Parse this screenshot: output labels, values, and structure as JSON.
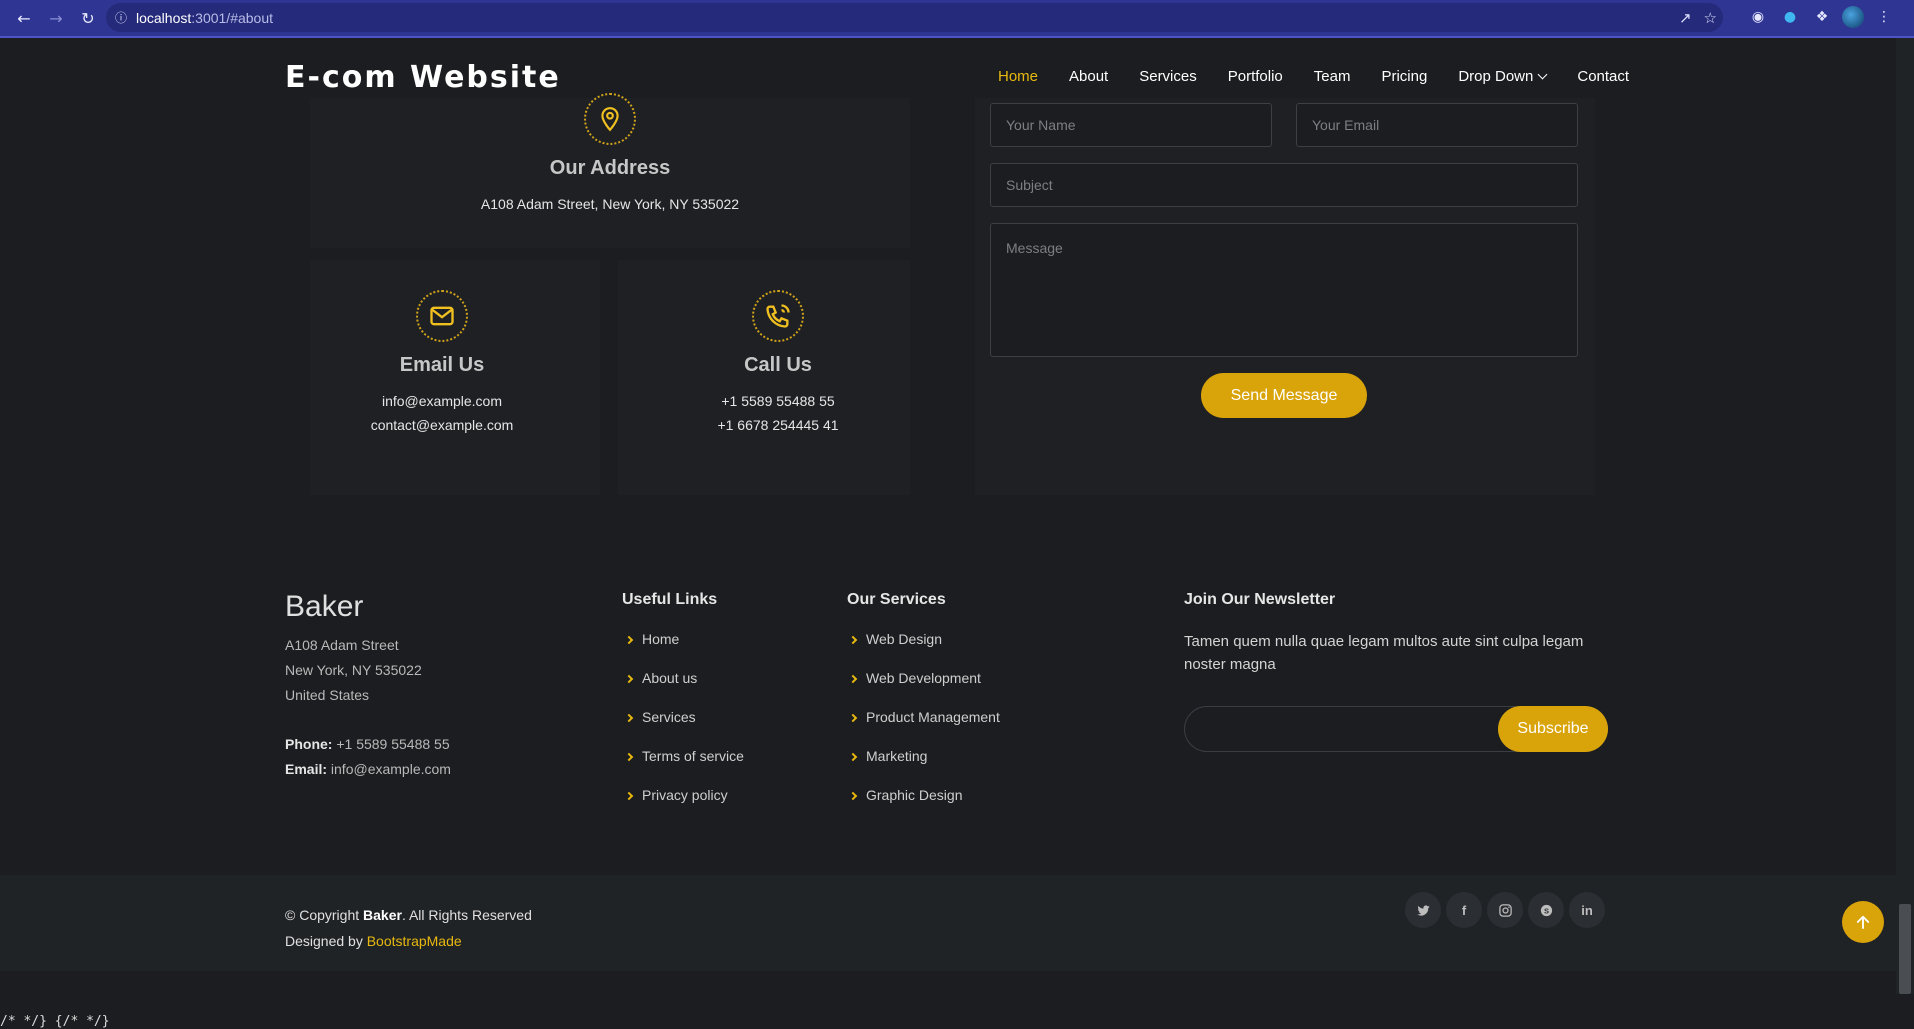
{
  "browser": {
    "url_host": "localhost",
    "url_path": ":3001/#about"
  },
  "header": {
    "brand": "E-com Website",
    "menu": [
      "Home",
      "About",
      "Services",
      "Portfolio",
      "Team",
      "Pricing",
      "Drop Down",
      "Contact"
    ],
    "active": "Home"
  },
  "contact": {
    "address": {
      "title": "Our Address",
      "line": "A108 Adam Street, New York, NY 535022"
    },
    "email": {
      "title": "Email Us",
      "lines": [
        "info@example.com",
        "contact@example.com"
      ]
    },
    "call": {
      "title": "Call Us",
      "lines": [
        "+1 5589 55488 55",
        "+1 6678 254445 41"
      ]
    },
    "form": {
      "name_placeholder": "Your Name",
      "email_placeholder": "Your Email",
      "subject_placeholder": "Subject",
      "message_placeholder": "Message",
      "send_label": "Send Message"
    }
  },
  "footer": {
    "brand": "Baker",
    "address_lines": [
      "A108 Adam Street",
      "New York, NY 535022",
      "United States"
    ],
    "phone_label": "Phone:",
    "phone": "+1 5589 55488 55",
    "email_label": "Email:",
    "email": "info@example.com",
    "useful_links_title": "Useful Links",
    "useful_links": [
      "Home",
      "About us",
      "Services",
      "Terms of service",
      "Privacy policy"
    ],
    "services_title": "Our Services",
    "services": [
      "Web Design",
      "Web Development",
      "Product Management",
      "Marketing",
      "Graphic Design"
    ],
    "newsletter_title": "Join Our Newsletter",
    "newsletter_text": "Tamen quem nulla quae legam multos aute sint culpa legam noster magna",
    "subscribe_label": "Subscribe",
    "copyright_prefix": "© Copyright",
    "copyright_brand": "Baker",
    "copyright_suffix": ". All Rights Reserved",
    "designed_by": "Designed by",
    "designer": "BootstrapMade",
    "social": [
      "twitter-icon",
      "facebook-icon",
      "instagram-icon",
      "skype-icon",
      "linkedin-icon"
    ]
  },
  "stray_text": "/* */} {/* */}",
  "colors": {
    "accent": "#e8b80f",
    "button": "#d9a30a",
    "bg": "#1b1d20",
    "browser": "#2f3592"
  }
}
